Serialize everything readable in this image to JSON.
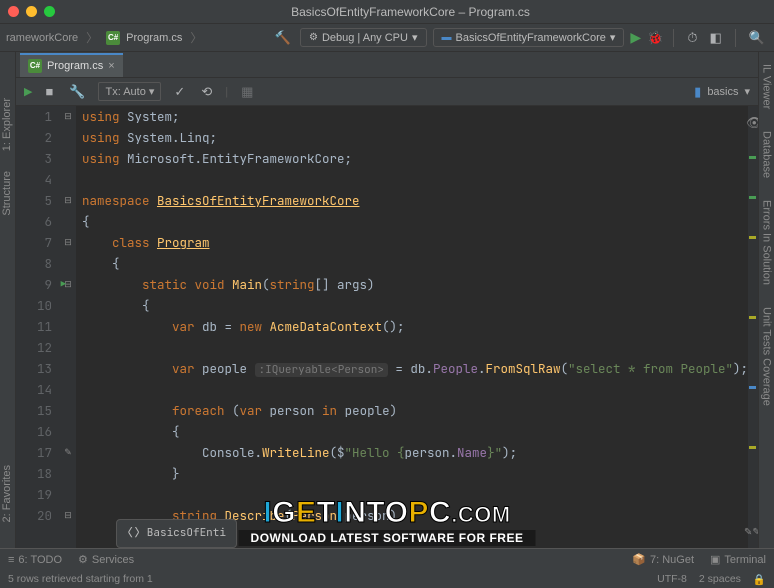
{
  "title": "BasicsOfEntityFrameworkCore – Program.cs",
  "breadcrumb": {
    "proj": "rameworkCore",
    "file": "Program.cs"
  },
  "configs": {
    "debug": "Debug | Any CPU",
    "project": "BasicsOfEntityFrameworkCore"
  },
  "tab": {
    "label": "Program.cs",
    "icon": "C#"
  },
  "toolbar": {
    "tx": "Tx: Auto",
    "basics": "basics"
  },
  "left_rail": {
    "explorer": "1: Explorer",
    "structure": "Structure",
    "favorites": "2: Favorites"
  },
  "right_rail": {
    "ilviewer": "IL Viewer",
    "database": "Database",
    "errors": "Errors In Solution",
    "coverage": "Unit Tests Coverage"
  },
  "code": {
    "lines": [
      {
        "n": 1,
        "seg": [
          [
            "k",
            "using "
          ],
          [
            "t",
            "System;"
          ]
        ]
      },
      {
        "n": 2,
        "seg": [
          [
            "k",
            "using "
          ],
          [
            "t",
            "System.Linq;"
          ]
        ]
      },
      {
        "n": 3,
        "seg": [
          [
            "k",
            "using "
          ],
          [
            "t",
            "Microsoft.EntityFrameworkCore;"
          ]
        ]
      },
      {
        "n": 4,
        "seg": []
      },
      {
        "n": 5,
        "seg": [
          [
            "k",
            "namespace "
          ],
          [
            "cls",
            "BasicsOfEntityFrameworkCore"
          ]
        ]
      },
      {
        "n": 6,
        "seg": [
          [
            "t",
            "{"
          ]
        ]
      },
      {
        "n": 7,
        "seg": [
          [
            "t",
            "    "
          ],
          [
            "k",
            "class "
          ],
          [
            "cls",
            "Program"
          ]
        ]
      },
      {
        "n": 8,
        "seg": [
          [
            "t",
            "    {"
          ]
        ]
      },
      {
        "n": 9,
        "marker": "▶",
        "seg": [
          [
            "t",
            "        "
          ],
          [
            "k",
            "static void "
          ],
          [
            "m",
            "Main"
          ],
          [
            "t",
            "("
          ],
          [
            "k",
            "string"
          ],
          [
            "t",
            "[] args)"
          ]
        ]
      },
      {
        "n": 10,
        "seg": [
          [
            "t",
            "        {"
          ]
        ]
      },
      {
        "n": 11,
        "seg": [
          [
            "t",
            "            "
          ],
          [
            "k",
            "var"
          ],
          [
            "t",
            " db = "
          ],
          [
            "k",
            "new "
          ],
          [
            "cls2",
            "AcmeDataContext"
          ],
          [
            "t",
            "();"
          ]
        ]
      },
      {
        "n": 12,
        "seg": []
      },
      {
        "n": 13,
        "seg": [
          [
            "t",
            "            "
          ],
          [
            "k",
            "var"
          ],
          [
            "t",
            " people "
          ],
          [
            "hint",
            ":IQueryable<Person>"
          ],
          [
            "t",
            " = db."
          ],
          [
            "id",
            "People"
          ],
          [
            "t",
            "."
          ],
          [
            "m",
            "FromSqlRaw"
          ],
          [
            "t",
            "("
          ],
          [
            "s",
            "\"select * from People\""
          ],
          [
            "t",
            ");"
          ]
        ]
      },
      {
        "n": 14,
        "seg": []
      },
      {
        "n": 15,
        "seg": [
          [
            "t",
            "            "
          ],
          [
            "k",
            "foreach"
          ],
          [
            "t",
            " ("
          ],
          [
            "k",
            "var"
          ],
          [
            "t",
            " person "
          ],
          [
            "k",
            "in"
          ],
          [
            "t",
            " people)"
          ]
        ]
      },
      {
        "n": 16,
        "seg": [
          [
            "t",
            "            {"
          ]
        ]
      },
      {
        "n": 17,
        "edit": true,
        "seg": [
          [
            "t",
            "                Console."
          ],
          [
            "m",
            "WriteLine"
          ],
          [
            "t",
            "($"
          ],
          [
            "s",
            "\"Hello {"
          ],
          [
            "t",
            "person."
          ],
          [
            "id",
            "Name"
          ],
          [
            "s",
            "}\""
          ],
          [
            "t",
            ");"
          ]
        ]
      },
      {
        "n": 18,
        "seg": [
          [
            "t",
            "            }"
          ]
        ]
      },
      {
        "n": 19,
        "seg": []
      },
      {
        "n": 20,
        "seg": [
          [
            "t",
            "            "
          ],
          [
            "k",
            "string "
          ],
          [
            "m",
            "Describe"
          ],
          [
            "t",
            "("
          ],
          [
            "cls2",
            "Person"
          ],
          [
            "t",
            " person)"
          ]
        ]
      }
    ]
  },
  "nav_hint": "BasicsOfEnti",
  "status": {
    "todo": "6: TODO",
    "services": "Services",
    "nuget": "7: NuGet",
    "terminal": "Terminal"
  },
  "message": "5 rows retrieved starting from 1",
  "footer": {
    "encoding": "UTF-8",
    "spaces": "2 spaces",
    "lock": "🔒"
  },
  "watermark": {
    "text": "IGETINTOPC.COM",
    "sub": "DOWNLOAD LATEST SOFTWARE FOR FREE"
  }
}
